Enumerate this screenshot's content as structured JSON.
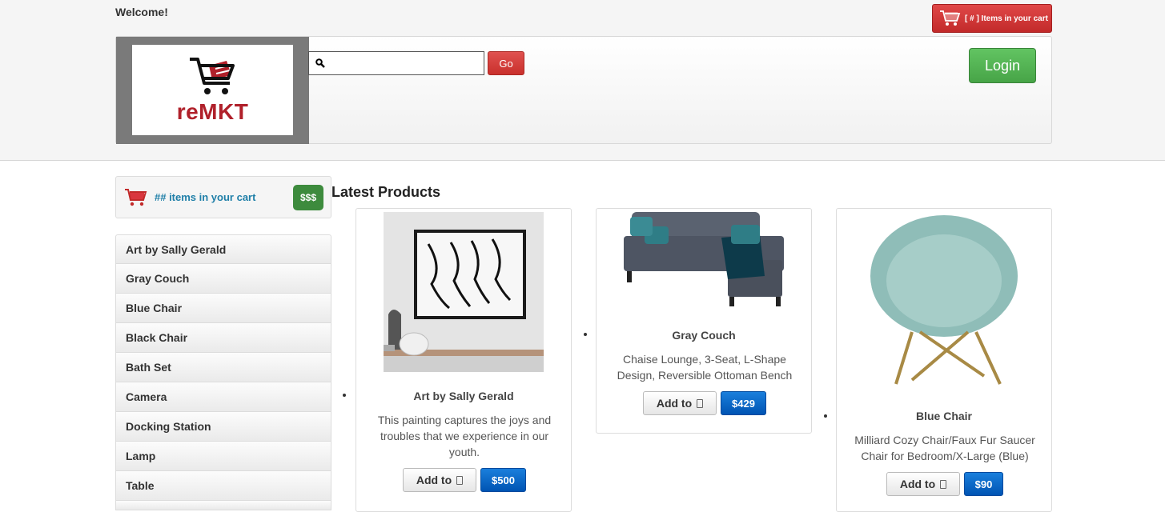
{
  "header": {
    "welcome": "Welcome!",
    "cart_button": "[ # ] Items in your cart",
    "logo_text": "reMKT",
    "search": {
      "value": "",
      "placeholder": ""
    },
    "go_label": "Go",
    "login_label": "Login"
  },
  "sidebar": {
    "cart_text": "## items in your cart",
    "cart_total": "$$$",
    "items": [
      {
        "label": "Art by Sally Gerald"
      },
      {
        "label": "Gray Couch"
      },
      {
        "label": "Blue Chair"
      },
      {
        "label": "Black Chair"
      },
      {
        "label": "Bath Set"
      },
      {
        "label": "Camera"
      },
      {
        "label": "Docking Station"
      },
      {
        "label": "Lamp"
      },
      {
        "label": "Table"
      }
    ]
  },
  "main": {
    "title": "Latest Products",
    "products": [
      {
        "name": "Art by Sally Gerald",
        "description": "This painting captures the joys and troubles that we experience in our youth.",
        "add_label": "Add to",
        "price": "$500"
      },
      {
        "name": "Gray Couch",
        "description": "Chaise Lounge, 3-Seat, L-Shape Design, Reversible Ottoman Bench",
        "add_label": "Add to",
        "price": "$429"
      },
      {
        "name": "Blue Chair",
        "description": "Milliard Cozy Chair/Faux Fur Saucer Chair for Bedroom/X-Large (Blue)",
        "add_label": "Add to",
        "price": "$90"
      }
    ]
  },
  "colors": {
    "brand_red": "#b0202a",
    "login_green": "#47a447",
    "price_blue": "#0054b3",
    "link_blue": "#1f7fa8"
  }
}
